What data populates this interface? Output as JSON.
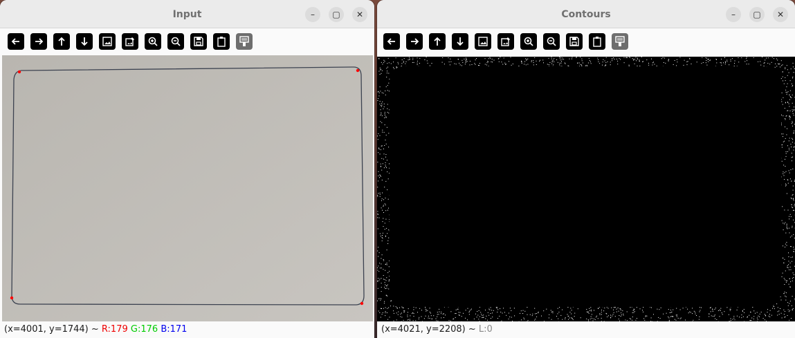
{
  "windows": {
    "input": {
      "title": "Input",
      "status": {
        "coords": "(x=4001, y=1744) ~",
        "r": "R:179",
        "g": "G:176",
        "b": "B:171"
      }
    },
    "contours": {
      "title": "Contours",
      "status": {
        "coords": "(x=4021, y=2208) ~",
        "l": "L:0"
      }
    }
  },
  "window_controls": {
    "minimize": "–",
    "maximize": "▢",
    "close": "✕"
  },
  "toolbar_icons": [
    "arrow-left-icon",
    "arrow-right-icon",
    "arrow-up-icon",
    "arrow-down-icon",
    "image-icon",
    "image-edit-icon",
    "zoom-in-icon",
    "zoom-out-icon",
    "save-icon",
    "clipboard-icon",
    "properties-icon"
  ],
  "colors": {
    "corner_marker": "#ff0000",
    "contour_line": "#3c4250",
    "paper": "#bdbab5"
  }
}
